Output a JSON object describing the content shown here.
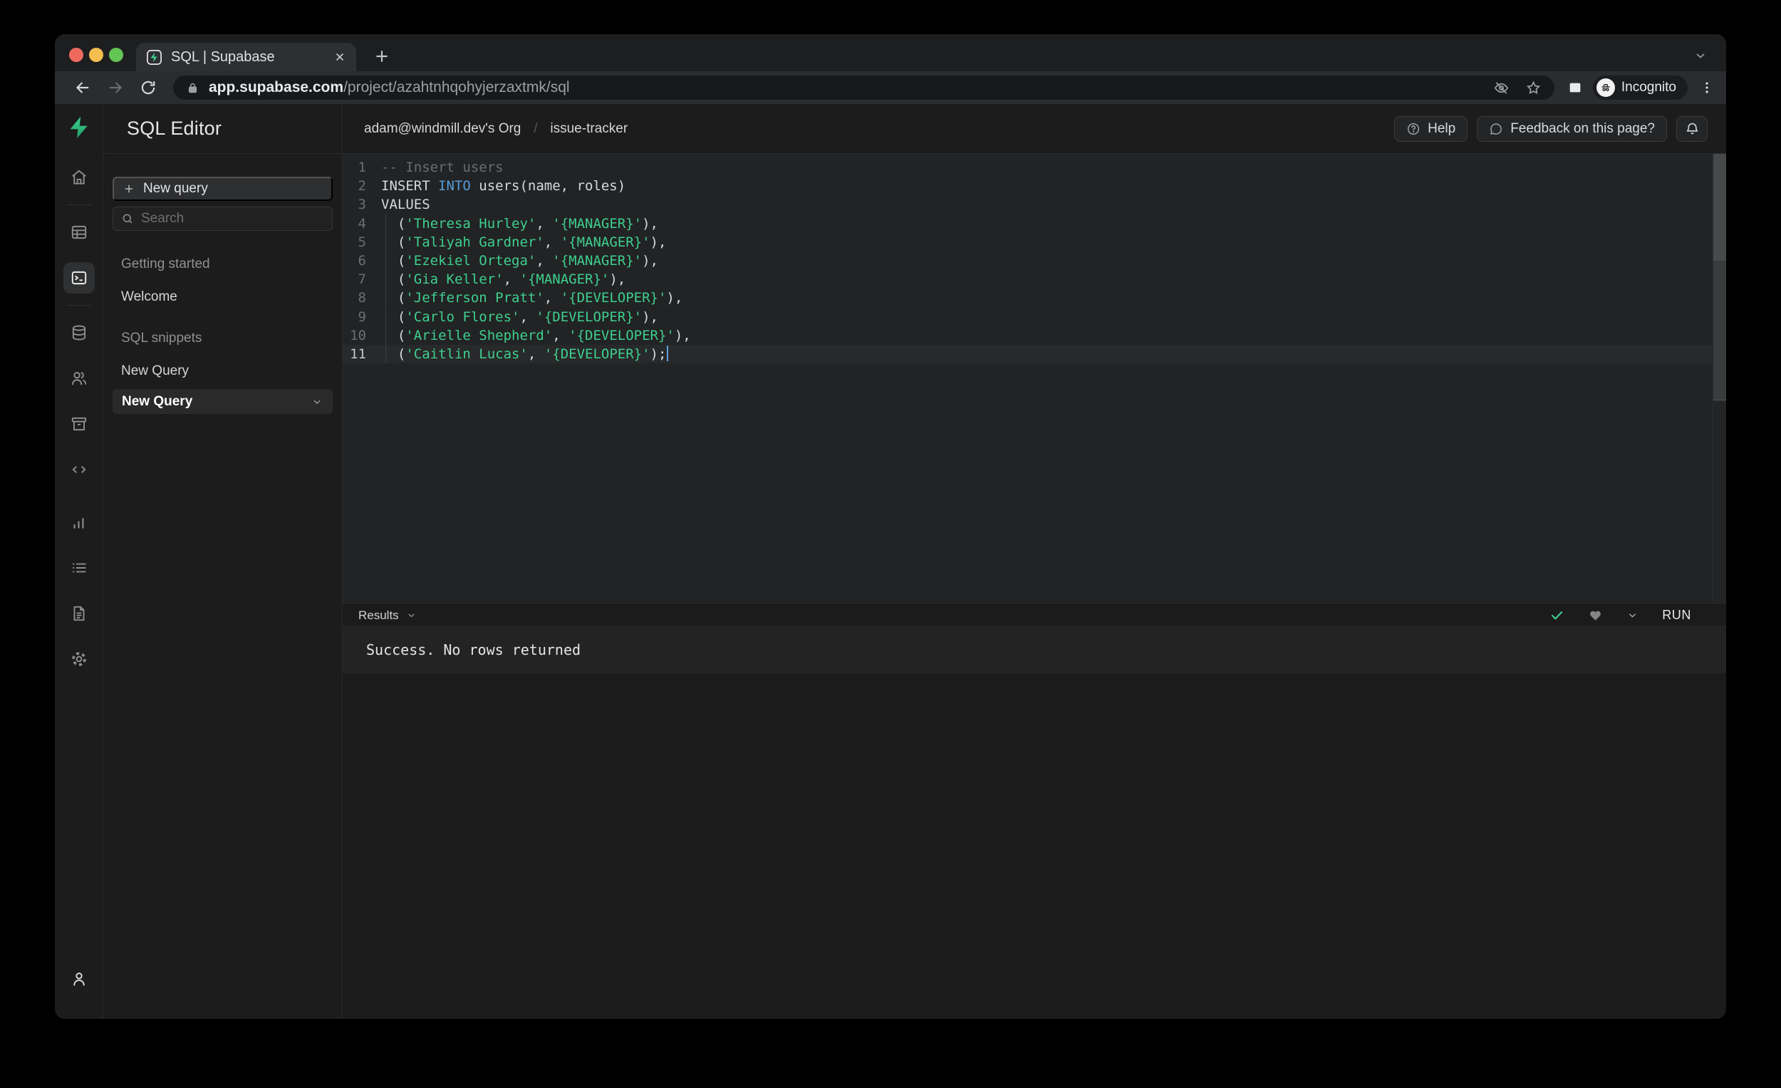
{
  "browser": {
    "tab_title": "SQL | Supabase",
    "url_domain": "app.supabase.com",
    "url_path": "/project/azahtnhqohyjerzaxtmk/sql",
    "incognito_label": "Incognito"
  },
  "header": {
    "app_title": "SQL Editor",
    "breadcrumb_org": "adam@windmill.dev's Org",
    "breadcrumb_sep": "/",
    "breadcrumb_project": "issue-tracker",
    "help_label": "Help",
    "feedback_label": "Feedback on this page?"
  },
  "rail": {
    "items": [
      "home",
      "table-editor",
      "sql-editor",
      "database",
      "auth-users",
      "storage",
      "edge-functions",
      "reports",
      "logs",
      "docs",
      "settings",
      "account"
    ],
    "selected": "sql-editor"
  },
  "sidebar_panel": {
    "new_query_button": "New query",
    "search_placeholder": "Search",
    "section1_heading": "Getting started",
    "welcome_item": "Welcome",
    "section2_heading": "SQL snippets",
    "query_item": "New Query",
    "selected_query_item": "New Query"
  },
  "editor": {
    "lines": [
      {
        "n": "1",
        "tokens": [
          [
            "comment",
            "-- Insert users"
          ]
        ]
      },
      {
        "n": "2",
        "tokens": [
          [
            "plain",
            "INSERT "
          ],
          [
            "keyword",
            "INTO"
          ],
          [
            "plain",
            " users(name, roles)"
          ]
        ]
      },
      {
        "n": "3",
        "tokens": [
          [
            "plain",
            "VALUES"
          ]
        ]
      },
      {
        "n": "4",
        "indent": true,
        "tokens": [
          [
            "plain",
            "  ("
          ],
          [
            "string",
            "'Theresa Hurley'"
          ],
          [
            "plain",
            ", "
          ],
          [
            "string",
            "'{MANAGER}'"
          ],
          [
            "plain",
            "),"
          ]
        ]
      },
      {
        "n": "5",
        "indent": true,
        "tokens": [
          [
            "plain",
            "  ("
          ],
          [
            "string",
            "'Taliyah Gardner'"
          ],
          [
            "plain",
            ", "
          ],
          [
            "string",
            "'{MANAGER}'"
          ],
          [
            "plain",
            "),"
          ]
        ]
      },
      {
        "n": "6",
        "indent": true,
        "tokens": [
          [
            "plain",
            "  ("
          ],
          [
            "string",
            "'Ezekiel Ortega'"
          ],
          [
            "plain",
            ", "
          ],
          [
            "string",
            "'{MANAGER}'"
          ],
          [
            "plain",
            "),"
          ]
        ]
      },
      {
        "n": "7",
        "indent": true,
        "tokens": [
          [
            "plain",
            "  ("
          ],
          [
            "string",
            "'Gia Keller'"
          ],
          [
            "plain",
            ", "
          ],
          [
            "string",
            "'{MANAGER}'"
          ],
          [
            "plain",
            "),"
          ]
        ]
      },
      {
        "n": "8",
        "indent": true,
        "tokens": [
          [
            "plain",
            "  ("
          ],
          [
            "string",
            "'Jefferson Pratt'"
          ],
          [
            "plain",
            ", "
          ],
          [
            "string",
            "'{DEVELOPER}'"
          ],
          [
            "plain",
            "),"
          ]
        ]
      },
      {
        "n": "9",
        "indent": true,
        "tokens": [
          [
            "plain",
            "  ("
          ],
          [
            "string",
            "'Carlo Flores'"
          ],
          [
            "plain",
            ", "
          ],
          [
            "string",
            "'{DEVELOPER}'"
          ],
          [
            "plain",
            "),"
          ]
        ]
      },
      {
        "n": "10",
        "indent": true,
        "tokens": [
          [
            "plain",
            "  ("
          ],
          [
            "string",
            "'Arielle Shepherd'"
          ],
          [
            "plain",
            ", "
          ],
          [
            "string",
            "'{DEVELOPER}'"
          ],
          [
            "plain",
            "),"
          ]
        ]
      },
      {
        "n": "11",
        "indent": true,
        "active": true,
        "cursor": true,
        "tokens": [
          [
            "plain",
            "  ("
          ],
          [
            "string",
            "'Caitlin Lucas'"
          ],
          [
            "plain",
            ", "
          ],
          [
            "string",
            "'{DEVELOPER}'"
          ],
          [
            "plain",
            ");"
          ]
        ]
      }
    ]
  },
  "results": {
    "label": "Results",
    "run_label": "RUN",
    "message": "Success. No rows returned"
  },
  "colors": {
    "brand_green": "#3ecf8e",
    "keyword_blue": "#569cd6",
    "string_green": "#3ecf8e",
    "comment_gray": "#6b6c6d",
    "traffic_red": "#ee6a5f",
    "traffic_yellow": "#f5bd4f",
    "traffic_green": "#62c554"
  }
}
